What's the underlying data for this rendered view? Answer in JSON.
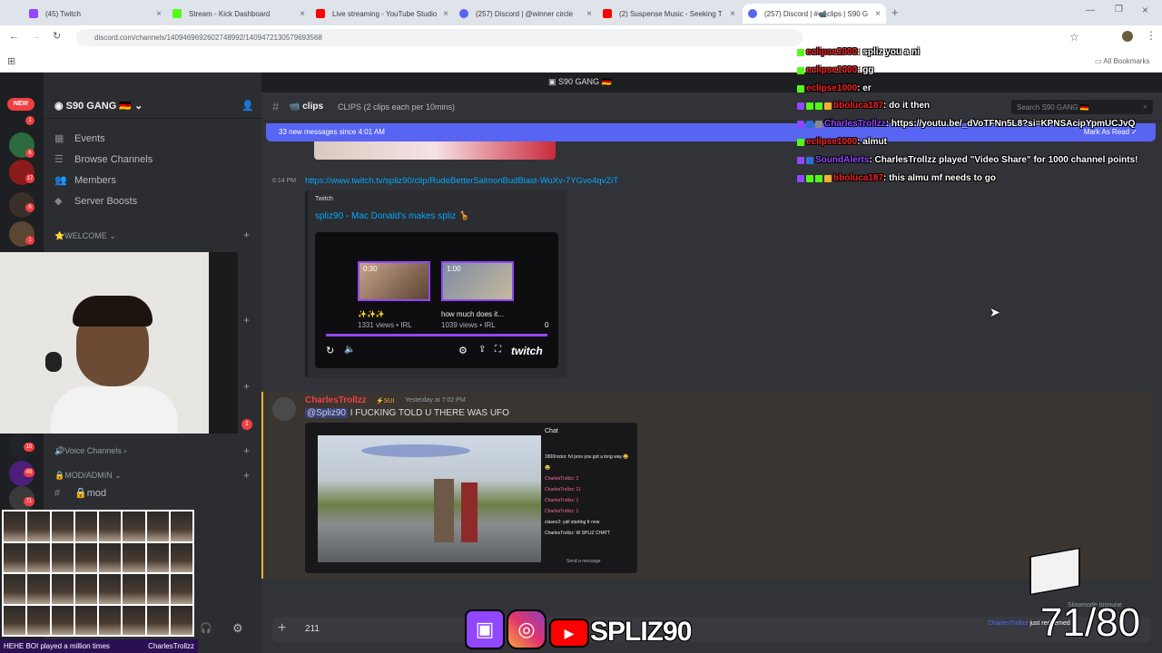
{
  "browser": {
    "tabs": [
      {
        "label": "(45) Twitch",
        "color": "#9146ff"
      },
      {
        "label": "Stream - Kick Dashboard",
        "color": "#53fc18"
      },
      {
        "label": "Live streaming - YouTube Studio",
        "color": "#ff0000"
      },
      {
        "label": "(257) Discord | @winner circle",
        "color": "#5865f2"
      },
      {
        "label": "(2) Suspense Music - Seeking T",
        "color": "#ff0000"
      },
      {
        "label": "(257) Discord | #📹clips | S90 G",
        "color": "#5865f2"
      }
    ],
    "url": "discord.com/channels/1409469692602748992/1409472130579693568",
    "all_bookmarks": "All Bookmarks"
  },
  "discord": {
    "window_title": "S90 GANG 🇩🇪",
    "server_name": "S90 GANG 🇩🇪",
    "new_badge": "NEW",
    "guild_badges": [
      "1",
      "6",
      "17",
      "6",
      "1",
      "10",
      "49",
      "71"
    ],
    "nav": [
      "Events",
      "Browse Channels",
      "Members",
      "Server Boosts"
    ],
    "categories": {
      "welcome": "⭐WELCOME",
      "voice": "🔊Voice Channels",
      "mod_admin": "🔒MOD/ADMIN"
    },
    "mod_channel": "🔒mod",
    "channel_name": "📹 clips",
    "channel_topic": "CLIPS (2 clips each per 10mins)",
    "new_messages_banner": "33 new messages since 4:01 AM",
    "mark_as_read": "Mark As Read",
    "search_placeholder": "Search S90 GANG 🇩🇪",
    "message1": {
      "time": "6:14 PM",
      "link": "https://www.twitch.tv/spliz90/clip/RudeBetterSalmonBudBlast-WuXv-7YGvo4qvZiT",
      "embed_provider": "Twitch",
      "embed_title": "spliz90 - Mac Donald's makes spliz 🦒",
      "clip1_duration": "0:30",
      "clip1_title": "✨✨✨",
      "clip1_meta": "1331 views • IRL",
      "clip2_duration": "1:00",
      "clip2_title": "how much does it...",
      "clip2_meta": "1039 views • IRL",
      "count": "0",
      "twitch_wordmark": "twitch"
    },
    "message2": {
      "author": "CharlesTrollzz",
      "tag": "⚡SUI",
      "time": "Yesterday at 7:02 PM",
      "mention": "@Spliz90",
      "text": "I FUCKING TOLD U THERE WAS UFO",
      "video_chat_header": "Chat",
      "video_chat_lines": [
        "1800rocks: fvl pros you got a long way 😂😂",
        "CharlesTrollzz: 1",
        "CharlesTrollzz: 11",
        "CharlesTrollzz: 1",
        "CharlesTrollzz: 1",
        "claseo2: yall starting fr now",
        "CharlesTrollzz: W SPLIZ CHATT"
      ],
      "video_send_placeholder": "Send a message"
    },
    "composer_count": "211",
    "slowmode": "Slowmode Immune"
  },
  "stream_chat": [
    {
      "user": "eclipse1000",
      "text": ": spliz you a ni",
      "color": "#ff1f1f"
    },
    {
      "user": "eclipse1000",
      "text": ": gg",
      "color": "#ff1f1f"
    },
    {
      "user": "eclipse1000",
      "text": ": er",
      "color": "#ff1f1f"
    },
    {
      "user": "bboluca187",
      "text": ": do it then",
      "color": "#ff1f1f"
    },
    {
      "user": "CharlesTrollzz",
      "text": ": https://youtu.be/_dVoTFNn5L8?si=KPNSAcipYpmUCJvQ",
      "color": "#9146ff"
    },
    {
      "user": "eclipse1000",
      "text": ": almut",
      "color": "#ff1f1f"
    },
    {
      "user": "SoundAlerts",
      "text": ": CharlesTrollzz played \"Video Share\" for 1000 channel points!",
      "color": "#9146ff"
    },
    {
      "user": "bboluca187",
      "text": ": this almu mf needs to go",
      "color": "#ff1f1f"
    }
  ],
  "overlay": {
    "counter": "71/80",
    "socials": "SPLIZ90",
    "alert_user": "CharlesTrollzz",
    "alert_text": "just redeemed",
    "bottom_left": "HEHE BOI played a million times",
    "bottom_right": "CharlesTrollzz"
  }
}
